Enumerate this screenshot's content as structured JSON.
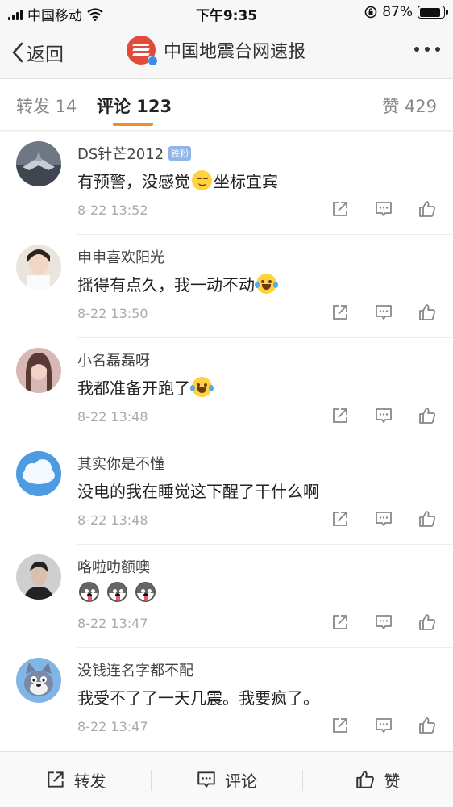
{
  "status_bar": {
    "carrier": "中国移动",
    "time": "下午9:35",
    "battery_percent": "87%",
    "battery_level": 0.87
  },
  "nav": {
    "back_label": "返回",
    "title": "中国地震台网速报"
  },
  "tabs": {
    "repost": "转发 14",
    "comment": "评论 123",
    "like": "赞 429"
  },
  "comments": [
    {
      "username": "DS针芒2012",
      "badge": "铁粉",
      "text_before": "有预警，没感觉",
      "emoji": "smirk-emoji",
      "text_after": "坐标宜宾",
      "time": "8-22 13:52"
    },
    {
      "username": "申申喜欢阳光",
      "text_before": "摇得有点久，我一动不动",
      "emoji": "laugh-cry-emoji",
      "text_after": "",
      "time": "8-22 13:50"
    },
    {
      "username": "小名磊磊呀",
      "text_before": "我都准备开跑了",
      "emoji": "laugh-cry-emoji",
      "text_after": "",
      "time": "8-22 13:48"
    },
    {
      "username": "其实你是不懂",
      "text_before": "没电的我在睡觉这下醒了干什么啊",
      "emoji": "",
      "text_after": "",
      "time": "8-22 13:48"
    },
    {
      "username": "咯啦叻额噢",
      "text_before": "",
      "emoji": "husky-emoji x3",
      "text_after": "",
      "time": "8-22 13:47"
    },
    {
      "username": "没钱连名字都不配",
      "text_before": "我受不了了一天几震。我要疯了。",
      "emoji": "",
      "text_after": "",
      "time": "8-22 13:47"
    }
  ],
  "bottom_bar": {
    "repost": "转发",
    "comment": "评论",
    "like": "赞"
  },
  "colors": {
    "accent": "#f08c2c",
    "logo": "#e24a3b",
    "verified": "#3a8ee6",
    "badge": "#8fb6e8"
  }
}
